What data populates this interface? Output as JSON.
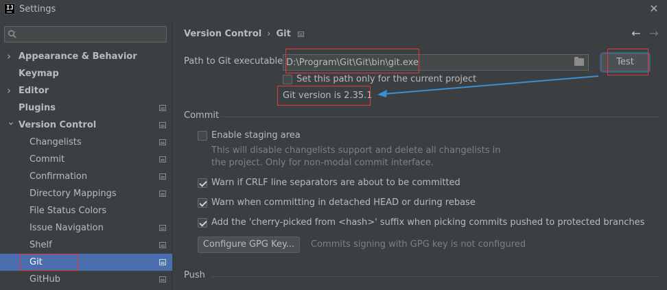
{
  "window": {
    "title": "Settings",
    "logo_text": "IJ"
  },
  "sidebar": {
    "search_placeholder": "",
    "items": [
      {
        "label": "Appearance & Behavior",
        "level": "top",
        "expand": "collapsed",
        "icon": ""
      },
      {
        "label": "Keymap",
        "level": "top",
        "expand": "none",
        "icon": ""
      },
      {
        "label": "Editor",
        "level": "top",
        "expand": "collapsed",
        "icon": ""
      },
      {
        "label": "Plugins",
        "level": "top",
        "expand": "none",
        "icon": "page-icon"
      },
      {
        "label": "Version Control",
        "level": "top",
        "expand": "expanded",
        "icon": "page-icon"
      },
      {
        "label": "Changelists",
        "level": "child",
        "icon": "page-icon"
      },
      {
        "label": "Commit",
        "level": "child",
        "icon": "page-icon"
      },
      {
        "label": "Confirmation",
        "level": "child",
        "icon": "page-icon"
      },
      {
        "label": "Directory Mappings",
        "level": "child",
        "icon": "page-icon"
      },
      {
        "label": "File Status Colors",
        "level": "child",
        "icon": ""
      },
      {
        "label": "Issue Navigation",
        "level": "child",
        "icon": "page-icon"
      },
      {
        "label": "Shelf",
        "level": "child",
        "icon": "page-icon"
      },
      {
        "label": "Git",
        "level": "child",
        "icon": "page-icon",
        "selected": true
      },
      {
        "label": "GitHub",
        "level": "child",
        "icon": "page-icon"
      }
    ]
  },
  "breadcrumb": {
    "parent": "Version Control",
    "separator": "›",
    "current": "Git"
  },
  "git_path": {
    "label": "Path to Git executable:",
    "value": "D:\\Program\\Git\\Git\\bin\\git.exe",
    "test_label": "Test",
    "project_only_label": "Set this path only for the current project",
    "project_only_checked": false,
    "version_text": "Git version is 2.35.1"
  },
  "commit": {
    "section_title": "Commit",
    "staging_label": "Enable staging area",
    "staging_checked": false,
    "staging_hint_1": "This will disable changelists support and delete all changelists in",
    "staging_hint_2": "the project. Only for non-modal commit interface.",
    "crlf_label": "Warn if CRLF line separators are about to be committed",
    "crlf_checked": true,
    "detached_label": "Warn when committing in detached HEAD or during rebase",
    "detached_checked": true,
    "cherry_label": "Add the 'cherry-picked from <hash>' suffix when picking commits pushed to protected branches",
    "cherry_checked": true,
    "gpg_button": "Configure GPG Key...",
    "gpg_note": "Commits signing with GPG key is not configured"
  },
  "push": {
    "section_title": "Push"
  },
  "colors": {
    "selection": "#4b6eaf",
    "annotation_red": "#e53935",
    "annotation_arrow": "#3a8fd8",
    "background": "#3c3f41"
  }
}
